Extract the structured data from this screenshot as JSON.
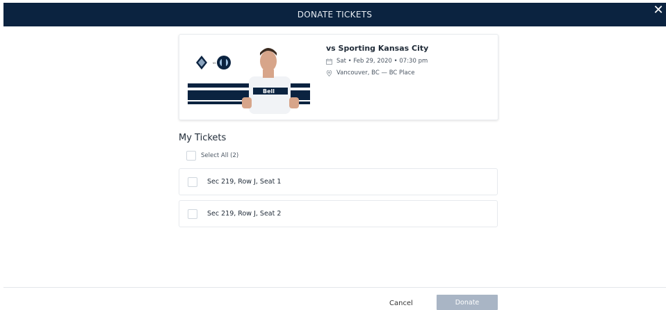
{
  "header": {
    "title": "DONATE TICKETS",
    "close_icon": "close-icon"
  },
  "event": {
    "opponent": "vs Sporting Kansas City",
    "datetime": "Sat • Feb 29, 2020 • 07:30 pm",
    "location": "Vancouver, BC — BC Place",
    "vs_text": "vs",
    "jersey_sponsor": "Bell"
  },
  "tickets": {
    "section_title": "My Tickets",
    "select_all_label": "Select All (2)",
    "items": [
      {
        "label": "Sec 219, Row J, Seat 1"
      },
      {
        "label": "Sec 219, Row J, Seat 2"
      }
    ]
  },
  "footer": {
    "cancel_label": "Cancel",
    "donate_label": "Donate"
  },
  "colors": {
    "header_bg": "#0b2340",
    "donate_disabled": "#a9b5c5"
  }
}
